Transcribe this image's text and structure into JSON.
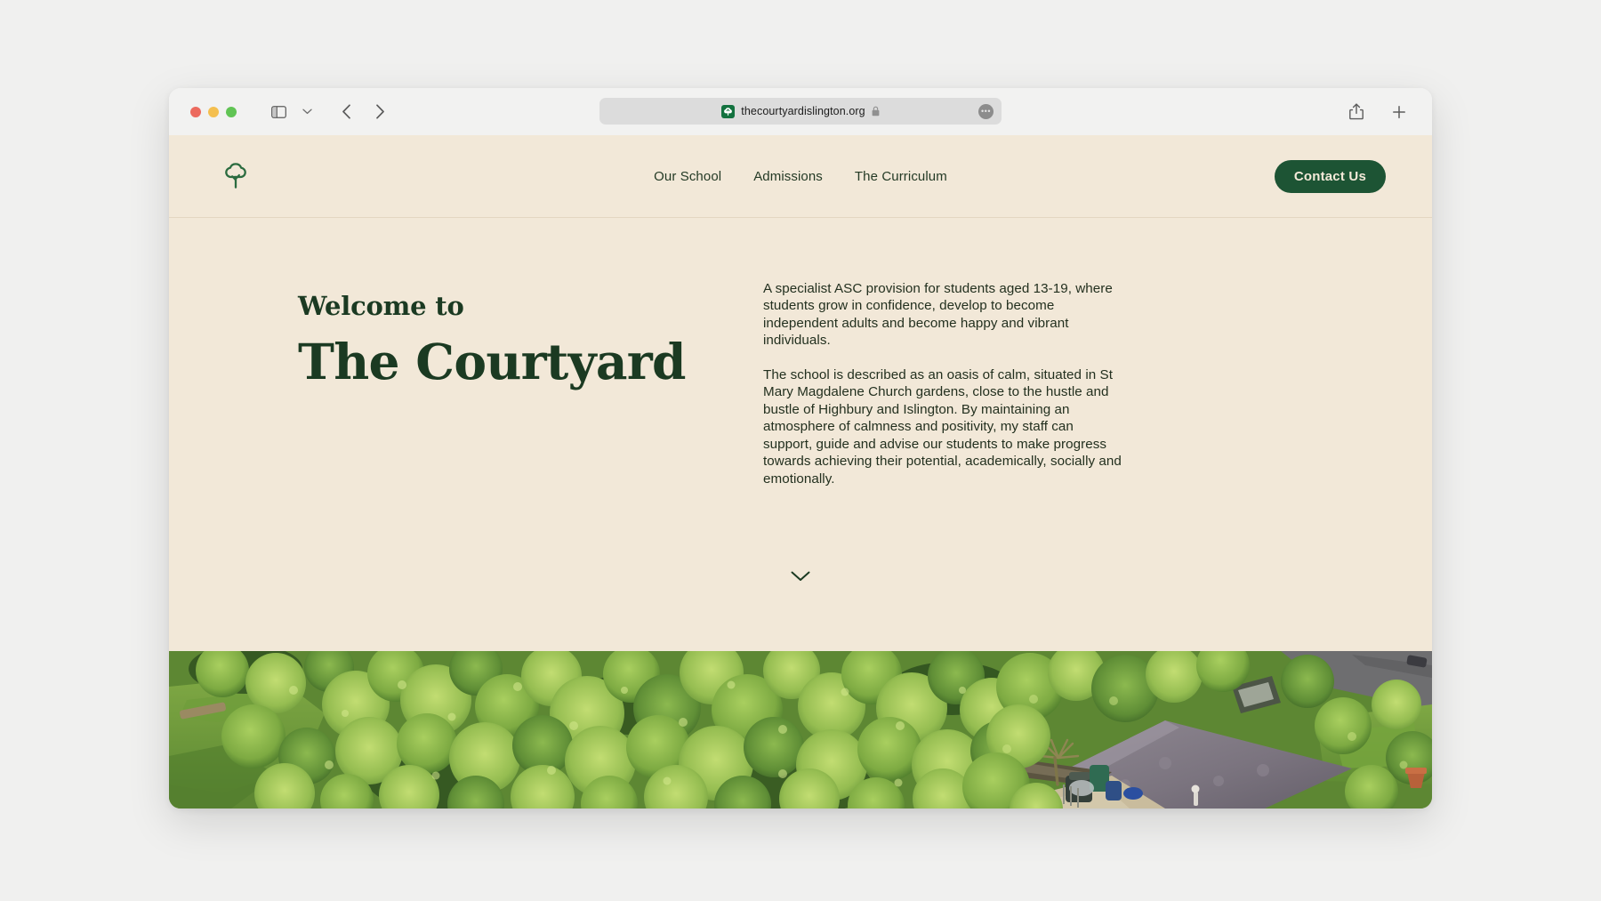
{
  "browser": {
    "traffic_lights": [
      "close",
      "minimize",
      "zoom"
    ],
    "sidebar_toggle_label": "Show sidebar",
    "tab_overview_label": "Tab overview",
    "back_label": "Back",
    "forward_label": "Forward",
    "url": "thecourtyardislington.org",
    "secure": true,
    "more_label": "•••",
    "share_label": "Share",
    "new_tab_label": "New Tab",
    "favicon_name": "tree-favicon"
  },
  "site": {
    "logo_name": "tree-logo",
    "nav": [
      {
        "label": "Our School"
      },
      {
        "label": "Admissions"
      },
      {
        "label": "The Curriculum"
      }
    ],
    "contact_button": "Contact Us",
    "hero": {
      "eyebrow": "Welcome to",
      "title": "The Courtyard",
      "paragraphs": [
        "A specialist ASC provision for students aged 13-19, where students grow in confidence, develop to become independent adults and become happy and vibrant individuals.",
        "The school is described as an oasis of calm, situated in St Mary Magdalene Church gardens, close to the hustle and bustle of Highbury and Islington. By maintaining an atmosphere of calmness and positivity, my staff can support, guide and advise our students to make progress towards achieving their potential, academically, socially and emotionally."
      ],
      "scroll_hint_name": "chevron-down-icon"
    },
    "photo_alt": "Aerial view of green tree canopy with school courtyard and rooftops",
    "colors": {
      "cream": "#f2e8d8",
      "dark_green": "#1d5434",
      "text_green": "#1b3a22",
      "button_text": "#f4ead9"
    }
  }
}
